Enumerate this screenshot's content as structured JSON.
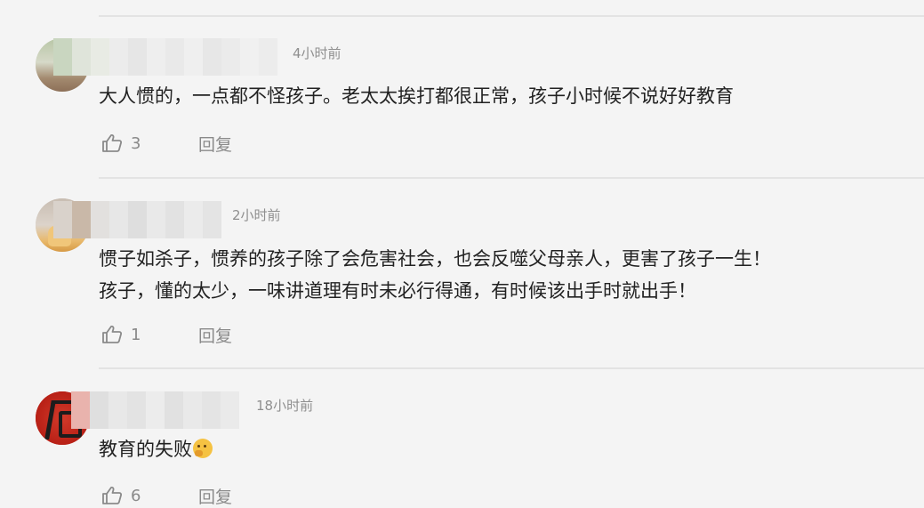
{
  "comments": [
    {
      "time": "4小时前",
      "lines": [
        "大人惯的，一点都不怪孩子。老太太挨打都很正常，孩子小时候不说好好教育"
      ],
      "likes": "3",
      "reply_label": "回复",
      "colors": {
        "avatar_bg": "#c7cbb4",
        "blur_blocks": [
          "#c9d6c0",
          "#7fbcb6",
          "#dfe4da",
          "#e8ebe4",
          "#ececec",
          "#e6e6e6",
          "#eeeeee",
          "#e9e9e9",
          "#efefef",
          "#e7e7e7"
        ]
      }
    },
    {
      "time": "2小时前",
      "lines": [
        "惯子如杀子，惯养的孩子除了会危害社会，也会反噬父母亲人，更害了孩子一生！",
        "孩子，懂的太少，一味讲道理有时未必行得通，有时候该出手时就出手！"
      ],
      "likes": "1",
      "reply_label": "回复",
      "colors": {
        "avatar_bg": "#d8cfc4",
        "blur_blocks": [
          "#d9d2cb",
          "#c9b8a8",
          "#e2e0de",
          "#e7e7e7",
          "#dedede",
          "#e9e9e9",
          "#e2e2e2",
          "#ebebeb",
          "#e4e4e4",
          "#e8e8e8"
        ]
      }
    },
    {
      "time": "18小时前",
      "lines": [
        "教育的失败"
      ],
      "emoji": "thinking-face-icon",
      "likes": "6",
      "reply_label": "回复",
      "colors": {
        "avatar_bg": "#c4281f",
        "blur_blocks": [
          "#e9b3ad",
          "#dfdfdf",
          "#e8e8e8",
          "#e3e3e3",
          "#ececec",
          "#e1e1e1",
          "#e9e9e9",
          "#e4e4e4",
          "#eaeaea",
          "#e6e6e6"
        ]
      }
    }
  ]
}
